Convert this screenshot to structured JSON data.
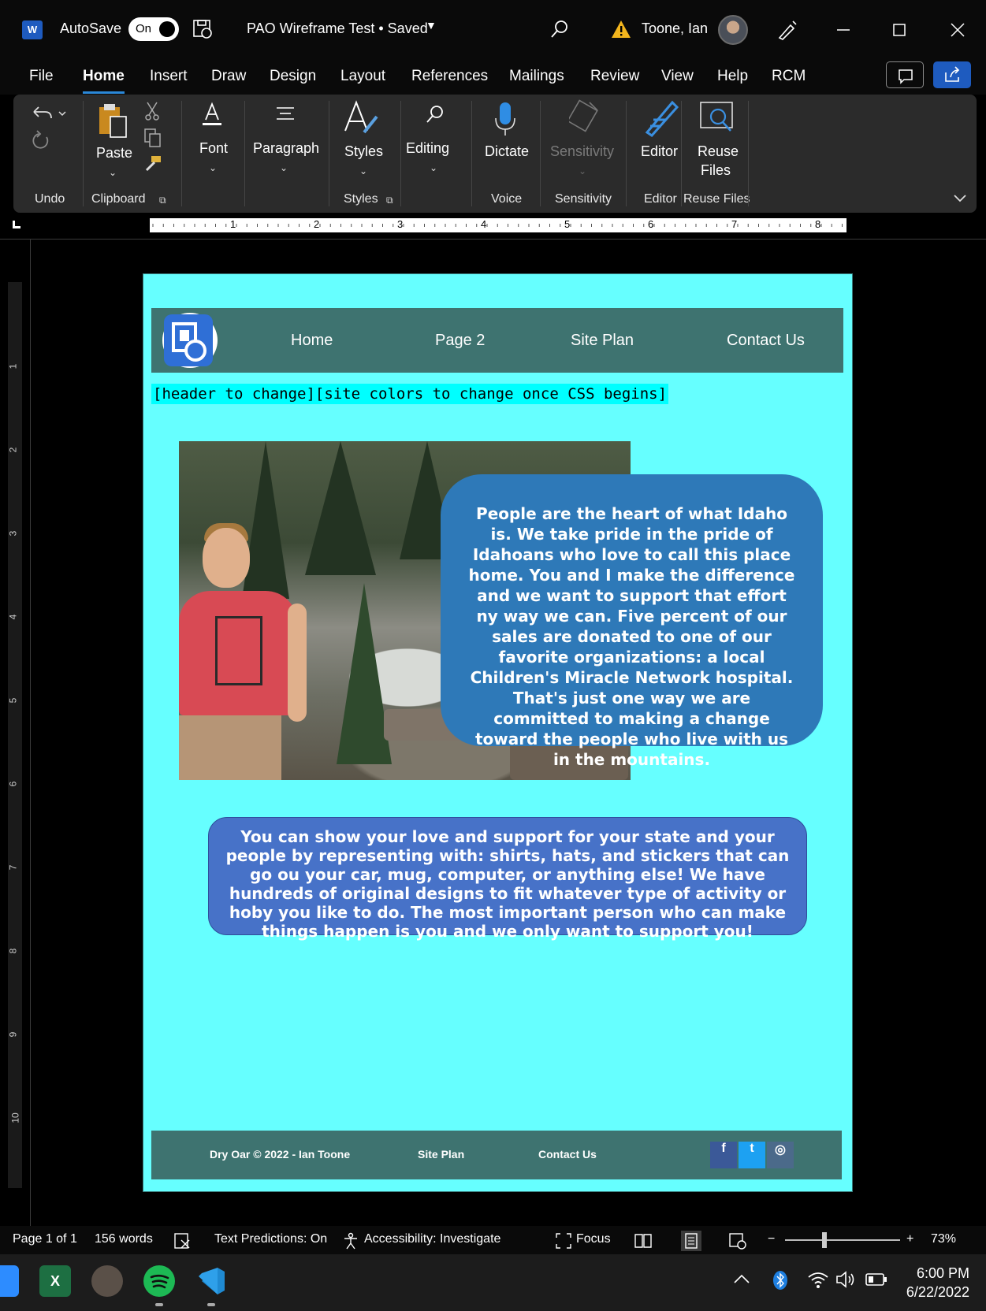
{
  "titlebar": {
    "app_icon_letter": "W",
    "autosave_label": "AutoSave",
    "autosave_state": "On",
    "document_title": "PAO Wireframe Test • Saved",
    "user_name": "Toone, Ian"
  },
  "menu": {
    "tabs": [
      "File",
      "Home",
      "Insert",
      "Draw",
      "Design",
      "Layout",
      "References",
      "Mailings",
      "Review",
      "View",
      "Help",
      "RCM"
    ],
    "active_tab": "Home"
  },
  "ribbon": {
    "undo_group": "Undo",
    "paste": "Paste",
    "clipboard_group": "Clipboard",
    "font": "Font",
    "paragraph": "Paragraph",
    "styles": "Styles",
    "styles_group": "Styles",
    "editing": "Editing",
    "dictate": "Dictate",
    "voice_group": "Voice",
    "sensitivity": "Sensitivity",
    "sensitivity_group": "Sensitivity",
    "editor": "Editor",
    "editor_group": "Editor",
    "reuse_files_line1": "Reuse",
    "reuse_files_line2": "Files",
    "reuse_files_group": "Reuse Files"
  },
  "ruler": {
    "h_numbers": [
      "1",
      "2",
      "3",
      "4",
      "5",
      "6",
      "7",
      "8"
    ],
    "v_numbers": [
      "1",
      "2",
      "3",
      "4",
      "5",
      "6",
      "7",
      "8",
      "9",
      "10"
    ]
  },
  "page": {
    "nav_links": [
      "Home",
      "Page 2",
      "Site Plan",
      "Contact Us"
    ],
    "header_note": "[header to change][site colors to change once CSS begins]",
    "bubble1_text": "People are the heart of what Idaho is. We take pride in the pride of Idahoans who love to call this place home. You and I make the difference and we want to support that effort ny way we can. Five percent of our sales are donated to one of our favorite organizations: a local Children's Miracle Network hospital. That's just one way we are committed to making a change toward the people who live with us in the mountains.",
    "bubble2_text": "You can show your love and support for your state and your people by representing with: shirts, hats, and stickers that can go ou your car, mug, computer, or anything else! We have hundreds of original designs to fit whatever type of activity or hoby you like to do. The most important person who can make things happen is you and we only want to support you!",
    "footer": {
      "copyright": "Dry Oar © 2022 - Ian Toone",
      "site_plan": "Site Plan",
      "contact": "Contact Us",
      "facebook": "f",
      "twitter": "t",
      "instagram": "◎"
    }
  },
  "statusbar": {
    "page": "Page 1 of 1",
    "words": "156 words",
    "text_predictions": "Text Predictions: On",
    "accessibility": "Accessibility: Investigate",
    "focus": "Focus",
    "zoom_minus": "−",
    "zoom_plus": "+",
    "zoom": "73%"
  },
  "taskbar": {
    "time": "6:00 PM",
    "date": "6/22/2022",
    "excel_letter": "X"
  },
  "colors": {
    "accent": "#2b88d8",
    "page_bg": "#66ffff",
    "site_nav": "#3e7370",
    "bubble1": "#2e79b8",
    "bubble2": "#4772c8"
  }
}
